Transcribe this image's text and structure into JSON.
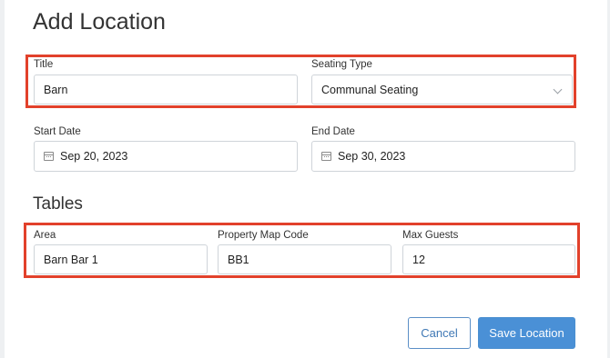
{
  "page": {
    "title": "Add Location"
  },
  "location": {
    "title_label": "Title",
    "title_value": "Barn",
    "seating_label": "Seating Type",
    "seating_value": "Communal Seating",
    "start_label": "Start Date",
    "start_value": "Sep 20, 2023",
    "end_label": "End Date",
    "end_value": "Sep 30, 2023"
  },
  "tables": {
    "heading": "Tables",
    "area_label": "Area",
    "area_value": "Barn Bar 1",
    "code_label": "Property Map Code",
    "code_value": "BB1",
    "guests_label": "Max Guests",
    "guests_value": "12"
  },
  "actions": {
    "cancel_label": "Cancel",
    "save_label": "Save Location"
  },
  "colors": {
    "highlight": "#e2412b",
    "primary": "#4a90d6"
  },
  "icons": {
    "calendar": "calendar-icon",
    "dropdown": "chevron-down-icon"
  }
}
